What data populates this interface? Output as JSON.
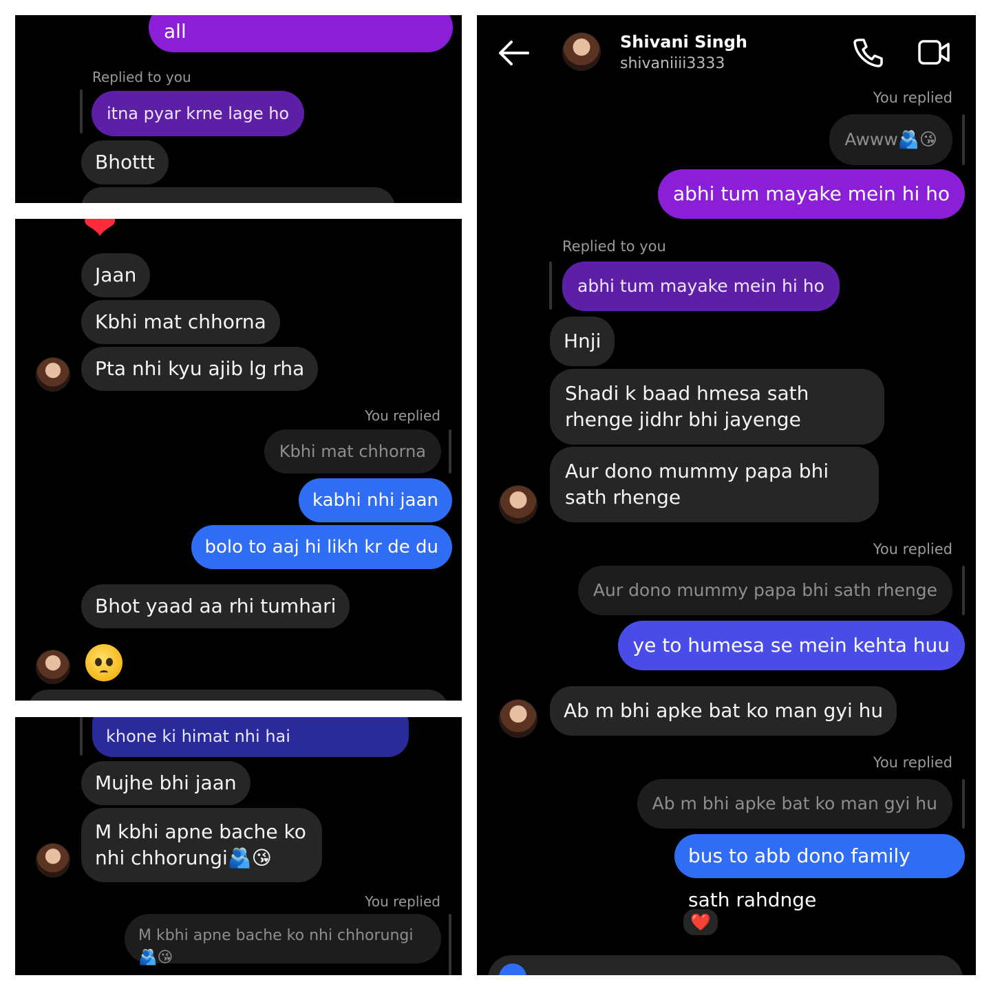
{
  "panel1": {
    "sent_partial": "all",
    "replied_label": "Replied to you",
    "quote": "itna pyar krne lage ho",
    "msg1": "Bhottt"
  },
  "panel2": {
    "reaction_top": "❤",
    "msgs": [
      "Jaan",
      "Kbhi mat chhorna",
      "Pta nhi kyu ajib lg rha"
    ],
    "you_replied": "You replied",
    "quoted": "Kbhi mat chhorna",
    "sent": [
      "kabhi nhi jaan",
      "bolo to aaj hi likh kr de du"
    ],
    "msg_after": "Bhot yaad aa rhi tumhari",
    "emoji_name": "pleading-face"
  },
  "panel3": {
    "quote_partial": "khone ki himat nhi hai",
    "msgs": [
      "Mujhe bhi jaan",
      "M kbhi apne bache ko nhi chhorungi🫂😘"
    ],
    "you_replied": "You replied",
    "quoted": "M kbhi apne bache ko nhi chhorungi🫂😘"
  },
  "panel4": {
    "header": {
      "name": "Shivani Singh",
      "username": "shivaniiii3333",
      "back_icon": "arrow-left",
      "call_icon": "phone",
      "video_icon": "video-camera"
    },
    "you_replied_1": "You replied",
    "quoted_1": "Awww🫂😘",
    "sent_1": "abhi tum mayake mein hi ho",
    "replied_to_you": "Replied to you",
    "quote_2": "abhi tum mayake mein hi ho",
    "recv": [
      "Hnji",
      "Shadi k baad hmesa sath rhenge jidhr bhi jayenge",
      "Aur dono mummy papa bhi sath rhenge"
    ],
    "you_replied_2": "You replied",
    "quoted_2": "Aur dono mummy papa bhi sath rhenge",
    "sent_2": "ye to humesa se mein kehta huu",
    "recv_2": "Ab m bhi apke bat ko man gyi hu",
    "you_replied_3": "You replied",
    "quoted_3": "Ab m bhi apke bat ko man gyi hu",
    "sent_3": "bus to abb dono family sath rahdnge",
    "reaction": "❤️"
  }
}
